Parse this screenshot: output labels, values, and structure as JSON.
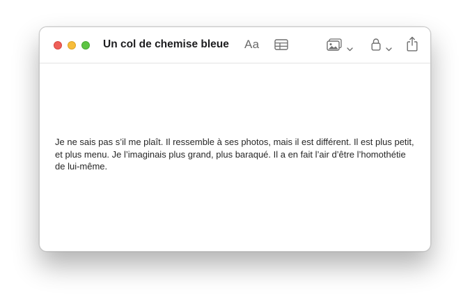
{
  "window": {
    "title": "Un col de chemise bleue"
  },
  "toolbar": {
    "format_label": "Aa",
    "icons": {
      "format": "text-format-icon",
      "table": "table-icon",
      "media": "media-icon",
      "lock": "lock-icon",
      "share": "share-icon"
    }
  },
  "note": {
    "body": "Je ne sais pas s’il me plaît. Il ressemble à ses photos, mais il est différent. Il est plus petit, et plus menu. Je l’imaginais plus grand, plus baraqué. Il a en fait l’air d’être l’homothétie de lui-même."
  },
  "colors": {
    "close": "#ee5f58",
    "minimize": "#f7bd3a",
    "maximize": "#5ec443",
    "icon": "#6e6e6e",
    "text": "#262626"
  }
}
